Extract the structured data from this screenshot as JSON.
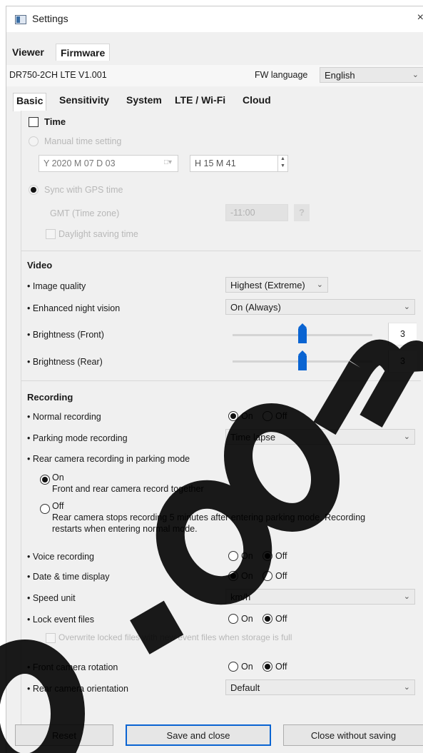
{
  "window": {
    "title": "Settings",
    "close_glyph": "×"
  },
  "top_tabs": [
    {
      "label": "Viewer",
      "active": false
    },
    {
      "label": "Firmware",
      "active": true
    }
  ],
  "device": {
    "model": "DR750-2CH LTE  V1.001",
    "fw_language_label": "FW language",
    "fw_language_value": "English"
  },
  "sub_tabs": [
    {
      "label": "Basic",
      "active": true
    },
    {
      "label": "Sensitivity",
      "active": false
    },
    {
      "label": "System",
      "active": false
    },
    {
      "label": "LTE / Wi-Fi",
      "active": false
    },
    {
      "label": "Cloud",
      "active": false
    }
  ],
  "time": {
    "title": "Time",
    "checked": false,
    "manual_label": "Manual time setting",
    "date_value": "Y 2020 M 07 D 03",
    "time_value": "H 15 M 41",
    "gps_label": "Sync with GPS time",
    "gmt_label": "GMT (Time zone)",
    "gmt_value": "-11:00",
    "gmt_help": "?",
    "dst_label": "Daylight saving time"
  },
  "video": {
    "title": "Video",
    "image_quality_label": "• Image quality",
    "image_quality_value": "Highest (Extreme)",
    "night_vision_label": "• Enhanced night vision",
    "night_vision_value": "On (Always)",
    "brightness_front_label": "• Brightness (Front)",
    "brightness_front_value": "3",
    "brightness_rear_label": "• Brightness (Rear)",
    "brightness_rear_value": "3",
    "brightness_fraction": 0.5
  },
  "recording": {
    "title": "Recording",
    "normal_label": "• Normal recording",
    "normal_on": "On",
    "normal_off": "Off",
    "normal_selected": "On",
    "parking_label": "• Parking mode recording",
    "parking_value": "Time lapse",
    "rear_parking_label": "• Rear camera recording in parking mode",
    "rear_on_label": "On",
    "rear_on_desc": "Front and rear camera record together",
    "rear_off_label": "Off",
    "rear_off_desc_1": "Rear camera stops recording 5 minutes after entering parking mode. Recording",
    "rear_off_desc_2": "restarts when entering normal mode.",
    "rear_selected": "On",
    "voice_label": "• Voice recording",
    "voice_selected": "Off",
    "datetime_label": "• Date & time display",
    "datetime_selected": "On",
    "speed_label": "• Speed unit",
    "speed_value": "km/h",
    "lock_label": "• Lock event files",
    "lock_selected": "Off",
    "overwrite_label": "Overwrite locked files with new event files when storage is full",
    "front_rot_label": "• Front camera rotation",
    "front_rot_selected": "Off",
    "rear_orient_label": "• Rear camera orientation",
    "rear_orient_value": "Default",
    "on_text": "On",
    "off_text": "Off"
  },
  "buttons": {
    "reset": "Reset",
    "save_close": "Save and close",
    "close_no_save": "Close without saving"
  },
  "colors": {
    "accent": "#0a64d2",
    "watermark": "#000000"
  },
  "icons": [
    "app-icon",
    "close-icon",
    "chevron-down-icon",
    "spinner-icon",
    "calendar-icon",
    "help-icon"
  ]
}
